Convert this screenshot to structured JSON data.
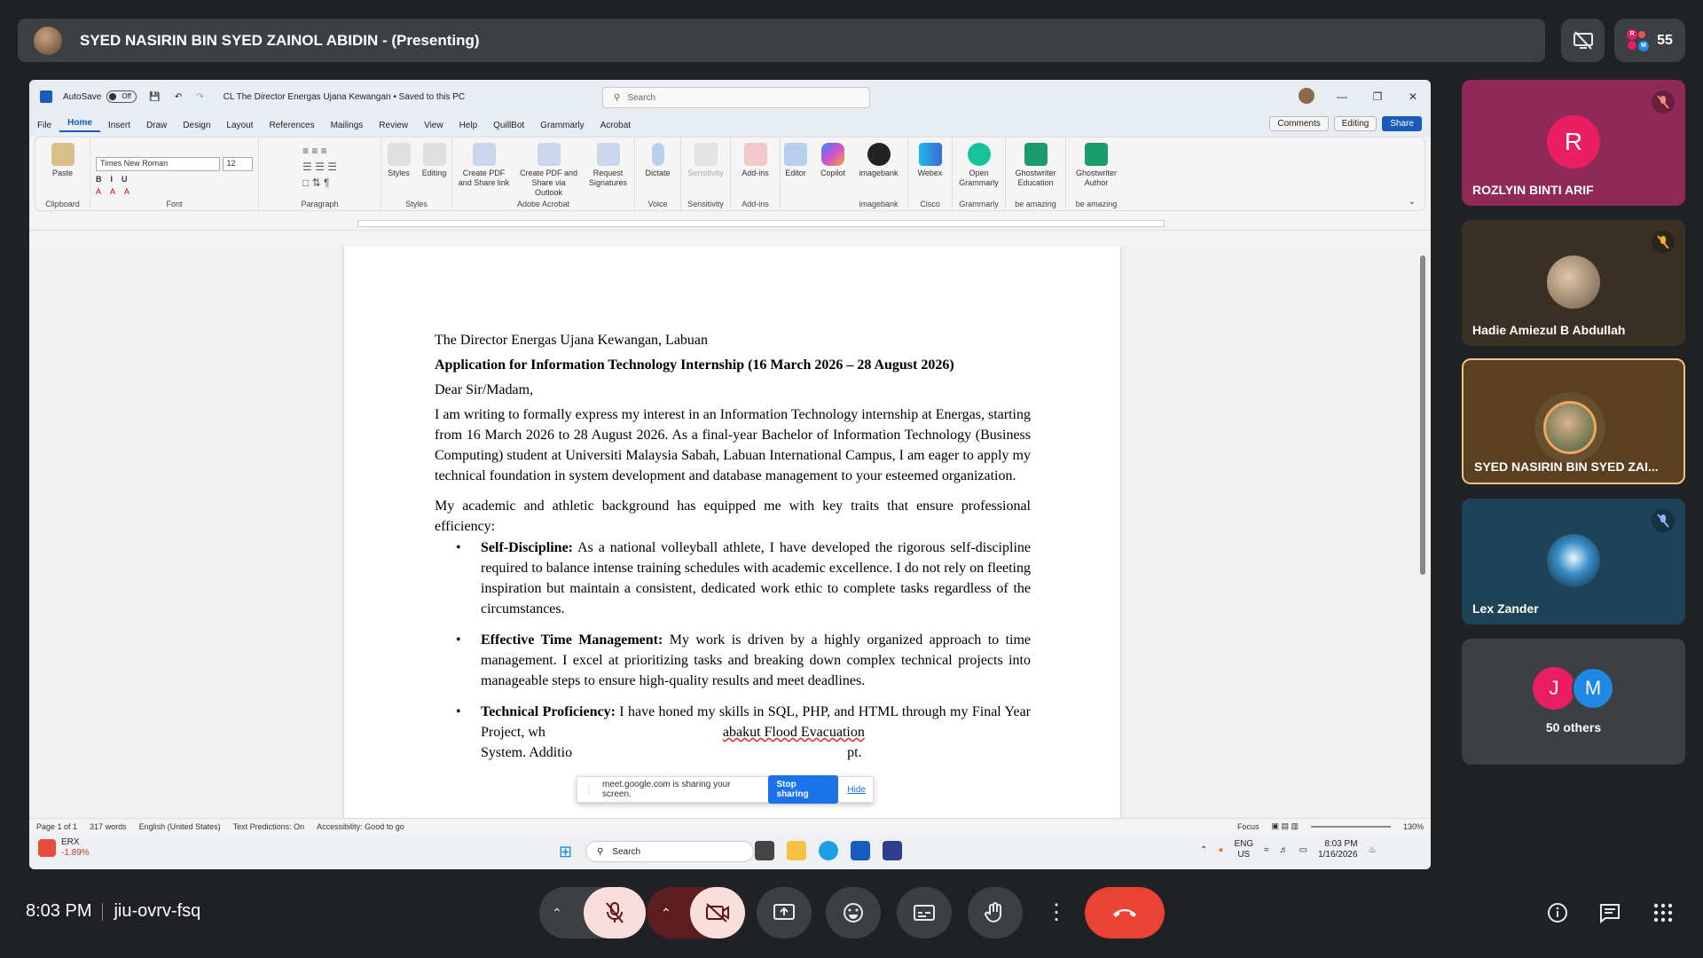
{
  "meeting": {
    "presenter_title": "SYED NASIRIN BIN SYED ZAINOL ABIDIN - (Presenting)",
    "participant_count": "55",
    "time": "8:03 PM",
    "meeting_code": "jiu-ovrv-fsq"
  },
  "word": {
    "autosave": "AutoSave",
    "autosave_state": "Off",
    "doc_title": "CL The Director Energas Ujana Kewangan • Saved to this PC",
    "search_placeholder": "Search",
    "menu": [
      "File",
      "Home",
      "Insert",
      "Draw",
      "Design",
      "Layout",
      "References",
      "Mailings",
      "Review",
      "View",
      "Help",
      "QuillBot",
      "Grammarly",
      "Acrobat"
    ],
    "comments": "Comments",
    "editing": "Editing",
    "share": "Share",
    "font_name": "Times New Roman",
    "font_size": "12",
    "ribbon_groups": {
      "clipboard": "Clipboard",
      "font": "Font",
      "paragraph": "Paragraph",
      "styles": "Styles",
      "adobe": "Adobe Acrobat",
      "voice": "Voice",
      "sensitivity": "Sensitivity",
      "addins": "Add-ins",
      "imagebank": "imagebank",
      "cisco": "Cisco",
      "grammarly": "Grammarly",
      "amazing": "be amazing"
    },
    "ribbon_buttons": {
      "paste": "Paste",
      "styles": "Styles",
      "editing": "Editing",
      "create_pdf": "Create PDF and Share link",
      "create_pdf_outlook": "Create PDF and Share via Outlook",
      "request_sig": "Request Signatures",
      "dictate": "Dictate",
      "sensitivity": "Sensitivity",
      "addins": "Add-ins",
      "editor": "Editor",
      "copilot": "Copilot",
      "imagebank": "imagebank",
      "webex": "Webex",
      "open_grammarly": "Open Grammarly",
      "gw_education": "Ghostwriter Education",
      "gw_author": "Ghostwriter Author"
    },
    "status": {
      "page": "Page 1 of 1",
      "words": "317 words",
      "language": "English (United States)",
      "predictions": "Text Predictions: On",
      "accessibility": "Accessibility: Good to go",
      "focus": "Focus",
      "zoom": "130%"
    }
  },
  "letter": {
    "line1": "The Director Energas Ujana Kewangan, Labuan",
    "subject": "Application for Information Technology Internship (16 March 2026 – 28 August 2026)",
    "salutation": "Dear Sir/Madam,",
    "para1": "I am writing to formally express my interest in an Information Technology internship at Energas, starting from 16 March 2026 to 28 August 2026. As a final-year Bachelor of Information Technology (Business Computing) student at Universiti Malaysia Sabah, Labuan International Campus, I am eager to apply my technical foundation in system development and database management to your esteemed organization.",
    "para2": "My academic and athletic background has equipped me with key traits that ensure professional efficiency:",
    "b1_head": "Self-Discipline:",
    "b1_text": " As a national volleyball athlete, I have developed the rigorous self-discipline required to balance intense training schedules with academic excellence. I do not rely on fleeting inspiration but maintain a consistent, dedicated work ethic to complete tasks regardless of the circumstances.",
    "b2_head": "Effective Time Management:",
    "b2_text": " My work is driven by a highly organized approach to time management. I excel at prioritizing tasks and breaking down complex technical projects into manageable steps to ensure high-quality results and meet deadlines.",
    "b3_head": "Technical Proficiency:",
    "b3_text": " I have honed my skills in SQL, PHP, and HTML through my Final Year Project, wh",
    "b3_text2": "abakut Flood Evacuation",
    "b3_text3": "System. Additio",
    "b3_text4": "pt."
  },
  "share_notice": {
    "text": "meet.google.com is sharing your screen.",
    "stop": "Stop sharing",
    "hide": "Hide"
  },
  "taskbar": {
    "stock": "ERX",
    "stock_change": "-1.89%",
    "search": "Search",
    "lang": "ENG",
    "region": "US",
    "time": "8:03 PM",
    "date": "1/16/2026"
  },
  "participants": [
    {
      "name": "ROZLYIN BINTI ARIF",
      "initial": "R",
      "muted": true
    },
    {
      "name": "Hadie Amiezul B Abdullah",
      "muted": true
    },
    {
      "name": "SYED NASIRIN BIN SYED ZAI...",
      "muted": false
    },
    {
      "name": "Lex Zander",
      "muted": true
    },
    {
      "name": "50 others",
      "initials": [
        "J",
        "M"
      ]
    }
  ],
  "colors": {
    "end_call": "#ea4335",
    "muted_btn": "#f9dedc",
    "word_blue": "#185abd",
    "rozlyin_tile": "#8e2a55",
    "hadie_tile": "#3b3024",
    "syed_tile": "#5a3f20",
    "lex_tile": "#1e4258"
  }
}
